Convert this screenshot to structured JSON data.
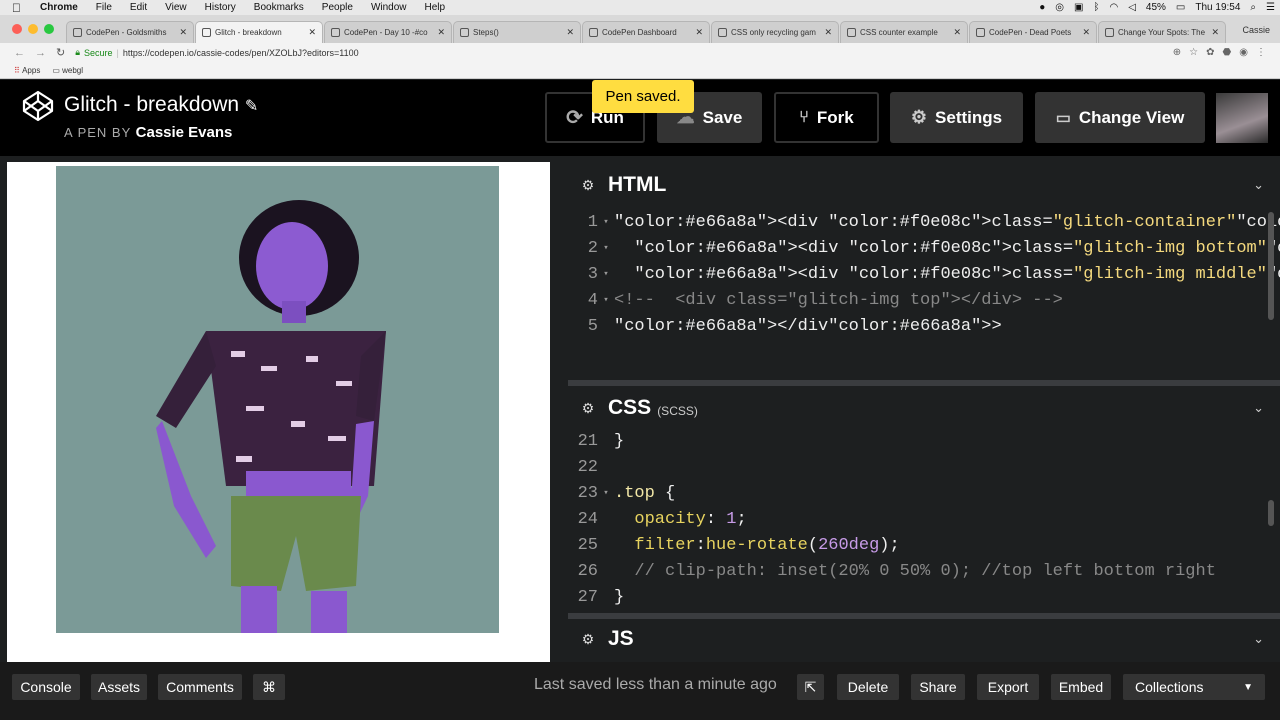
{
  "menubar": {
    "apple": "",
    "app": "Chrome",
    "items": [
      "File",
      "Edit",
      "View",
      "History",
      "Bookmarks",
      "People",
      "Window",
      "Help"
    ],
    "battery": "45%",
    "clock": "Thu 19:54"
  },
  "browser": {
    "tabs": [
      {
        "title": "CodePen - Goldsmiths",
        "active": false
      },
      {
        "title": "Glitch - breakdown",
        "active": true
      },
      {
        "title": "CodePen - Day 10 -#co",
        "active": false
      },
      {
        "title": "Steps()",
        "active": false
      },
      {
        "title": "CodePen Dashboard",
        "active": false
      },
      {
        "title": "CSS only recycling gam",
        "active": false
      },
      {
        "title": "CSS counter example",
        "active": false
      },
      {
        "title": "CodePen - Dead Poets",
        "active": false
      },
      {
        "title": "Change Your Spots: The",
        "active": false
      }
    ],
    "profile_name": "Cassie",
    "secure_label": "Secure",
    "url": "https://codepen.io/cassie-codes/pen/XZOLbJ?editors=1100",
    "bookmarks": [
      "Apps",
      "webgl"
    ]
  },
  "header": {
    "title": "Glitch - breakdown",
    "by_prefix": "A PEN BY",
    "author": "Cassie Evans",
    "buttons": {
      "run": "Run",
      "save": "Save",
      "fork": "Fork",
      "settings": "Settings",
      "change_view": "Change View"
    },
    "toast": "Pen saved."
  },
  "editors": {
    "html": {
      "name": "HTML",
      "lines": [
        {
          "n": "1",
          "fold": "▾",
          "text": "<div class=\"glitch-container\">"
        },
        {
          "n": "2",
          "fold": "▾",
          "text": "  <div class=\"glitch-img bottom\"></div>"
        },
        {
          "n": "3",
          "fold": "▾",
          "text": "  <div class=\"glitch-img middle\"></div>"
        },
        {
          "n": "4",
          "fold": "▾",
          "text": "<!--  <div class=\"glitch-img top\"></div> -->"
        },
        {
          "n": "5",
          "fold": "",
          "text": "</div>"
        }
      ]
    },
    "css": {
      "name": "CSS",
      "sub": "(SCSS)",
      "lines": [
        {
          "n": "21",
          "fold": "",
          "text": "}"
        },
        {
          "n": "22",
          "fold": "",
          "text": ""
        },
        {
          "n": "23",
          "fold": "▾",
          "text": ".top {"
        },
        {
          "n": "24",
          "fold": "",
          "text": "  opacity: 1;"
        },
        {
          "n": "25",
          "fold": "",
          "text": "  filter:hue-rotate(260deg);"
        },
        {
          "n": "26",
          "fold": "",
          "text": "  // clip-path: inset(20% 0 50% 0); //top left bottom right"
        },
        {
          "n": "27",
          "fold": "",
          "text": "}"
        }
      ]
    },
    "js": {
      "name": "JS"
    }
  },
  "footer": {
    "left": [
      "Console",
      "Assets",
      "Comments",
      "⌘"
    ],
    "status": "Last saved less than a minute ago",
    "right": [
      "Delete",
      "Share",
      "Export",
      "Embed"
    ],
    "collections": "Collections"
  },
  "colors": {
    "tag": "#e66a8a",
    "attr": "#f0e08c",
    "string": "#f4d97e",
    "comment": "#888888",
    "selector": "#f1e6a6",
    "property": "#e7d35f",
    "number": "#c79be7",
    "toast": "#ffdd40"
  }
}
